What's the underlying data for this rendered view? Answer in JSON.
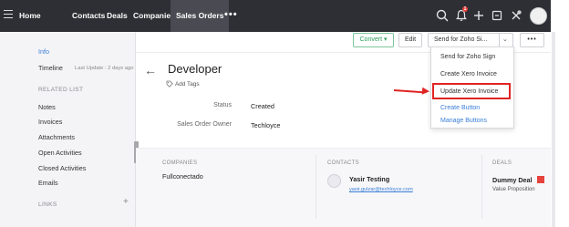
{
  "nav": {
    "items": [
      "Home",
      "Contacts",
      "Deals",
      "Companies"
    ],
    "active": "Sales Orders",
    "more": "•••",
    "notification_count": "1"
  },
  "sidebar": {
    "info": "Info",
    "timeline": "Timeline",
    "timeline_sub": "Last Update : 2 days ago",
    "related_heading": "RELATED LIST",
    "related_items": [
      "Notes",
      "Invoices",
      "Attachments",
      "Open Activities",
      "Closed Activities",
      "Emails"
    ],
    "links_heading": "LINKS",
    "plus": "+"
  },
  "toolbar": {
    "convert_label": "Convert",
    "convert_caret": "▾",
    "edit_label": "Edit",
    "send_label": "Send for Zoho Si...",
    "send_caret": "⌄",
    "more_label": "•••"
  },
  "record": {
    "back_glyph": "←",
    "title": "Developer",
    "add_tags": "Add Tags",
    "fields": [
      {
        "label": "Status",
        "value": "Created"
      },
      {
        "label": "Sales Order Owner",
        "value": "Techloyce"
      }
    ]
  },
  "dropdown": {
    "items": [
      "Send for Zoho Sign",
      "Create Xero Invoice",
      "Update Xero Invoice"
    ],
    "create_button": "Create Button",
    "manage_buttons": "Manage Buttons"
  },
  "related": {
    "companies_head": "COMPANIES",
    "company_name": "Fullconectado",
    "contacts_head": "CONTACTS",
    "contact_name": "Yasir Testing",
    "contact_email": "yasir.gulzar@techloyce.com",
    "deals_head": "DEALS",
    "deal_name": "Dummy Deal",
    "deal_stage": "Value Proposition"
  },
  "colors": {
    "topbar": "#2e2f35",
    "accent_blue": "#3a7ed8",
    "convert_green": "#2aa05a",
    "highlight_red": "#e02424"
  }
}
